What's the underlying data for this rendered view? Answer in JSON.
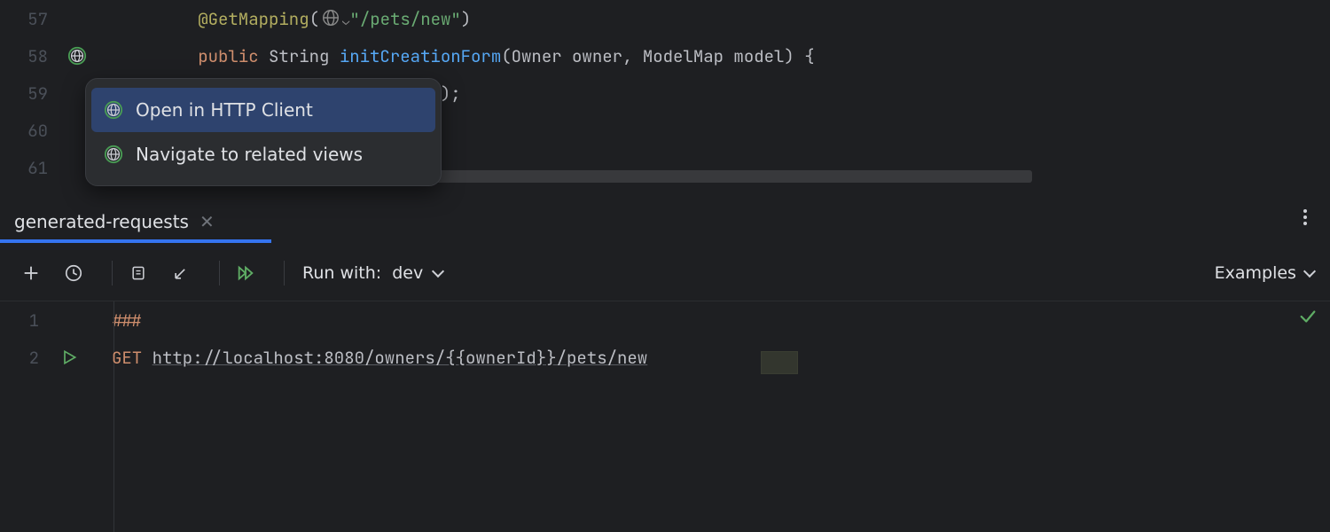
{
  "editor": {
    "lines": [
      {
        "n": "57",
        "ann": "@GetMapping",
        "path": "\"/pets/new\"",
        "rest": ""
      },
      {
        "n": "58",
        "pub": "public ",
        "ret": "String ",
        "mth": "initCreationForm",
        "sig": "(Owner owner, ModelMap model) {"
      },
      {
        "n": "59",
        "rest": ");"
      },
      {
        "n": "60",
        "rest": ""
      },
      {
        "n": "61",
        "rest": ""
      }
    ]
  },
  "menu": {
    "items": [
      {
        "label": "Open in HTTP Client",
        "selected": true
      },
      {
        "label": "Navigate to related views",
        "selected": false
      }
    ]
  },
  "tab": {
    "title": "generated-requests"
  },
  "toolbar": {
    "run_label": "Run with:",
    "env": "dev",
    "examples": "Examples"
  },
  "http": {
    "lines": [
      {
        "n": "1",
        "marker": "###"
      },
      {
        "n": "2",
        "method": "GET",
        "url": "http://localhost:8080/owners/{{ownerId}}/pets/new"
      }
    ]
  }
}
